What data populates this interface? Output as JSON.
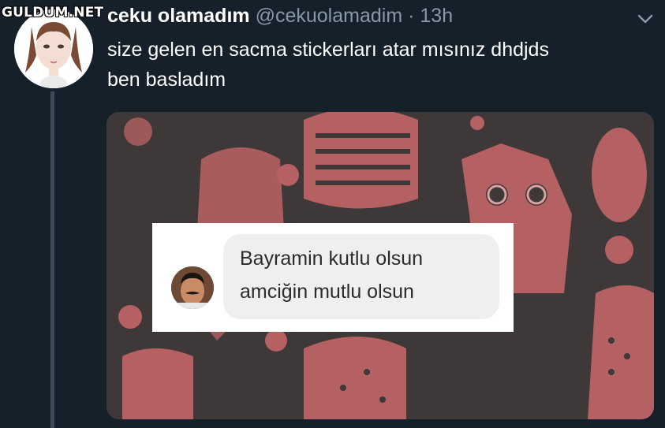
{
  "watermark": "GULDUM.NET",
  "tweet": {
    "display_name": "ceku olamadım",
    "handle": "@cekuolamadim",
    "separator": "·",
    "time": "13h",
    "text_line1": "size gelen en sacma stickerları atar mısınız dhdjds",
    "text_line2": "ben basladım"
  },
  "sticker_message": {
    "line1": "Bayramin kutlu olsun",
    "line2": "amciğin mutlu olsun"
  },
  "icons": {
    "menu": "chevron-down-icon"
  },
  "colors": {
    "background": "#15202b",
    "muted_text": "#8899a6",
    "owl_pink": "#b56063",
    "owl_bg": "#3e3838"
  }
}
